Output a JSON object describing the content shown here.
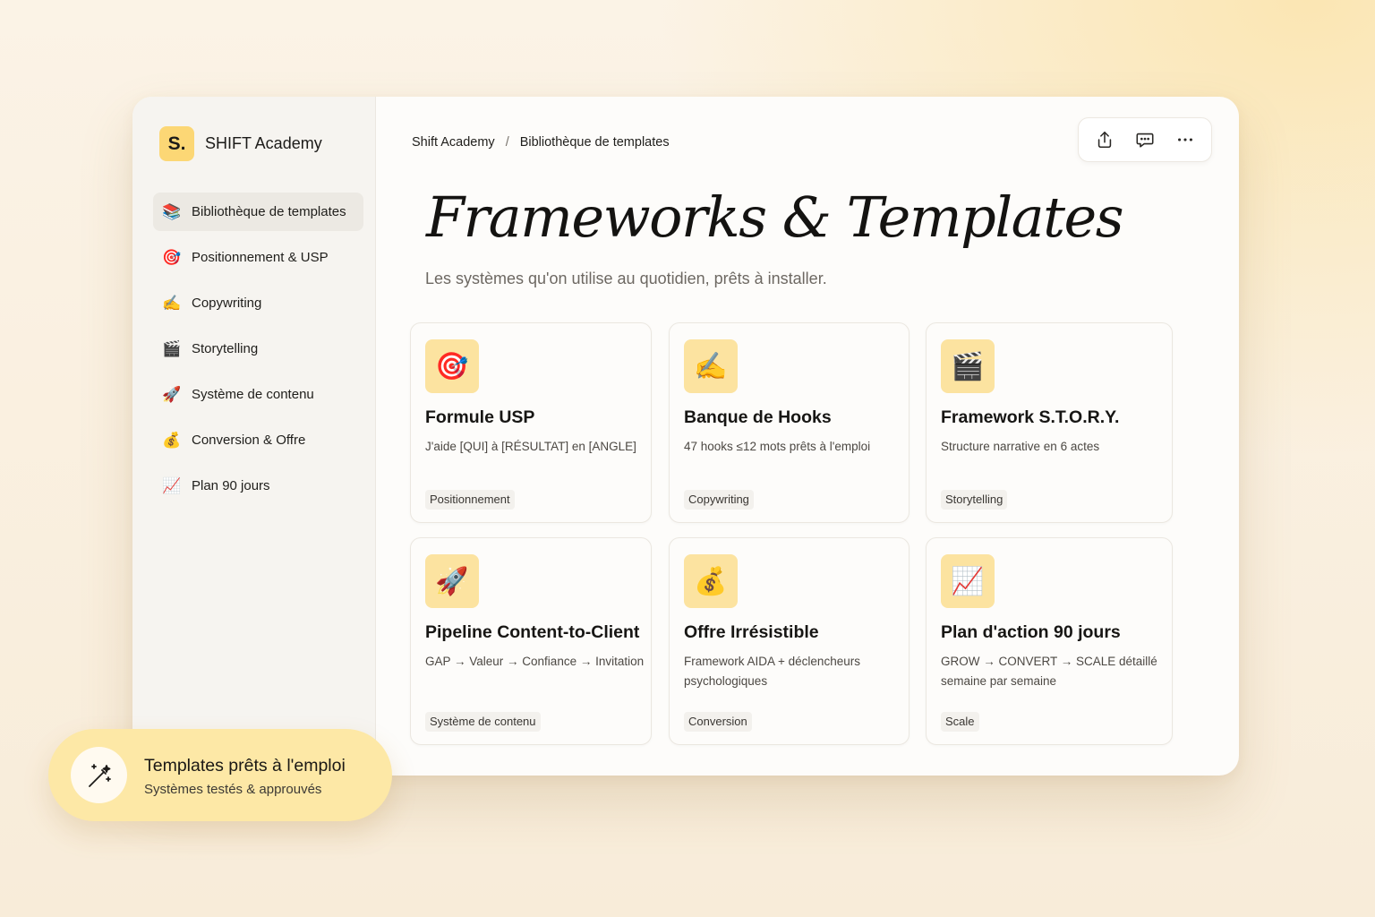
{
  "brand": {
    "logo_text": "S.",
    "name": "SHIFT Academy"
  },
  "sidebar": {
    "items": [
      {
        "icon": "books-icon",
        "glyph": "📚",
        "label": "Bibliothèque de templates",
        "active": true
      },
      {
        "icon": "target-icon",
        "glyph": "🎯",
        "label": "Positionnement & USP"
      },
      {
        "icon": "writing-hand-icon",
        "glyph": "✍️",
        "label": "Copywriting"
      },
      {
        "icon": "clapper-board-icon",
        "glyph": "🎬",
        "label": "Storytelling"
      },
      {
        "icon": "rocket-icon",
        "glyph": "🚀",
        "label": "Système de contenu"
      },
      {
        "icon": "money-bag-icon",
        "glyph": "💰",
        "label": "Conversion & Offre"
      },
      {
        "icon": "chart-up-icon",
        "glyph": "📈",
        "label": "Plan 90 jours"
      }
    ]
  },
  "breadcrumb": {
    "root": "Shift Academy",
    "separator": "/",
    "current": "Bibliothèque de templates"
  },
  "toolbar": {
    "share_icon": "share-icon",
    "comment_icon": "comment-icon",
    "more_icon": "more-icon"
  },
  "main": {
    "title": "Frameworks & Templates",
    "subtitle": "Les systèmes qu'on utilise au quotidien, prêts à installer.",
    "cards": [
      {
        "icon": "target-icon",
        "glyph": "🎯",
        "title": "Formule USP",
        "desc": "J'aide [QUI] à [RÉSULTAT] en [ANGLE]",
        "tag": "Positionnement"
      },
      {
        "icon": "writing-hand-icon",
        "glyph": "✍️",
        "title": "Banque de Hooks",
        "desc": "47 hooks ≤12 mots prêts à l'emploi",
        "tag": "Copywriting"
      },
      {
        "icon": "clapper-board-icon",
        "glyph": "🎬",
        "title": "Framework S.T.O.R.Y.",
        "desc": "Structure narrative en 6 actes",
        "tag": "Storytelling"
      },
      {
        "icon": "rocket-icon",
        "glyph": "🚀",
        "title": "Pipeline Content-to-Client",
        "desc": "GAP → Valeur → Confiance → Invitation",
        "tag": "Système de contenu"
      },
      {
        "icon": "money-bag-icon",
        "glyph": "💰",
        "title": "Offre Irrésistible",
        "desc": "Framework AIDA + déclencheurs psychologiques",
        "tag": "Conversion"
      },
      {
        "icon": "chart-up-icon",
        "glyph": "📈",
        "title": "Plan d'action 90 jours",
        "desc": "GROW → CONVERT → SCALE détaillé semaine par semaine",
        "tag": "Scale"
      }
    ]
  },
  "toast": {
    "icon": "magic-wand-icon",
    "title": "Templates prêts à l'emploi",
    "subtitle": "Systèmes testés & approuvés"
  },
  "colors": {
    "accent": "#fcd775",
    "card_icon_bg": "#fce3a0",
    "toast_bg": "#fde8a6"
  }
}
